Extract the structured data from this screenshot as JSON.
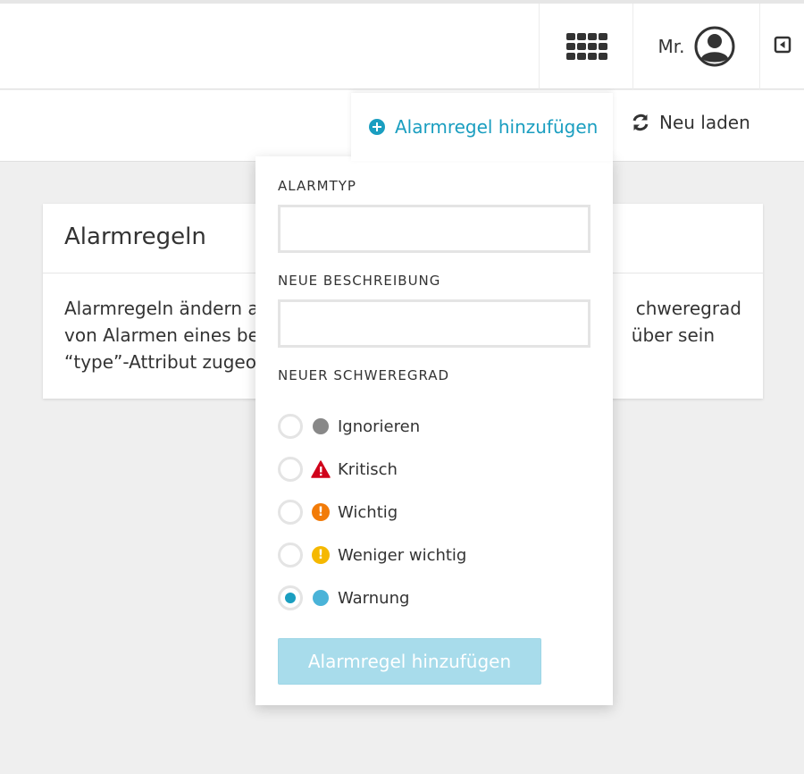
{
  "header": {
    "user_name": "Mr.",
    "icons": {
      "apps": "app-grid-icon",
      "user": "user-avatar-icon",
      "collapse": "collapse-panel-icon"
    }
  },
  "actions": {
    "add_rule_label": "Alarmregel hinzufügen",
    "reload_label": "Neu laden",
    "accent": "#1a9ec0"
  },
  "card": {
    "title": "Alarmregeln",
    "body_line1": "Alarmregeln ändern a",
    "body_line1_right": "chweregrad",
    "body_line2": "von Alarmen eines be",
    "body_line2_right": "über sein",
    "body_line3": "“type”-Attribut zugeor"
  },
  "form": {
    "alarm_type_label": "ALARMTYP",
    "alarm_type_value": "",
    "description_label": "NEUE BESCHREIBUNG",
    "description_value": "",
    "severity_label": "NEUER SCHWEREGRAD",
    "severities": [
      {
        "label": "Ignorieren",
        "icon": "gray-dot-icon",
        "color": "#888888",
        "checked": false
      },
      {
        "label": "Kritisch",
        "icon": "warning-triangle-icon",
        "color": "#d0021b",
        "checked": false
      },
      {
        "label": "Wichtig",
        "icon": "orange-exclamation-icon",
        "color": "#f27b08",
        "checked": false
      },
      {
        "label": "Weniger wichtig",
        "icon": "yellow-exclamation-icon",
        "color": "#f5b800",
        "checked": false
      },
      {
        "label": "Warnung",
        "icon": "blue-dot-icon",
        "color": "#4ab3d8",
        "checked": true
      }
    ],
    "submit_label": "Alarmregel hinzufügen"
  }
}
